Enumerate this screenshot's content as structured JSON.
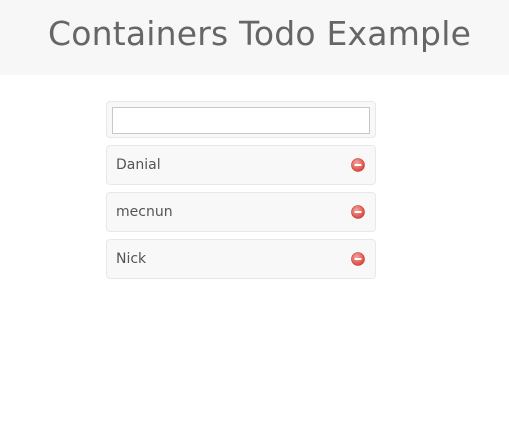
{
  "header": {
    "title": "Containers Todo Example"
  },
  "new_todo": {
    "value": "",
    "placeholder": ""
  },
  "todos": [
    {
      "label": "Danial",
      "remove_icon": "remove-icon"
    },
    {
      "label": "mecnun",
      "remove_icon": "remove-icon"
    },
    {
      "label": "Nick",
      "remove_icon": "remove-icon"
    }
  ],
  "colors": {
    "header_bg": "#f7f7f7",
    "title_text": "#666666",
    "card_bg": "#f8f8f8",
    "card_border": "#e8e8e8",
    "remove_icon": "#e0564f"
  }
}
